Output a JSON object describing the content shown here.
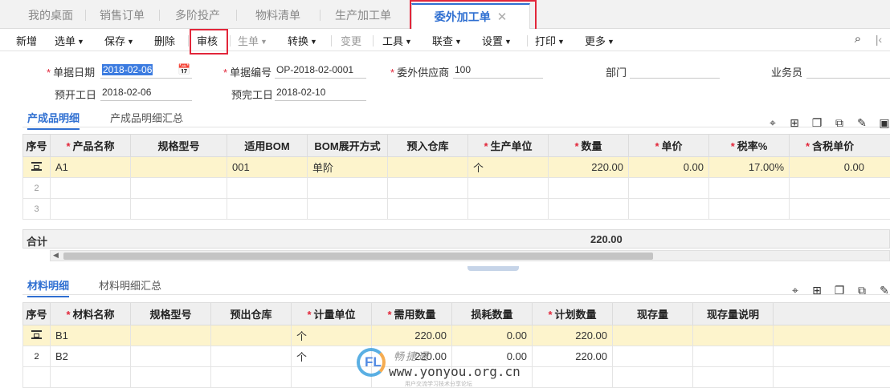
{
  "tabs": [
    {
      "label": "我的桌面"
    },
    {
      "label": "销售订单"
    },
    {
      "label": "多阶投产"
    },
    {
      "label": "物料清单"
    },
    {
      "label": "生产加工单"
    },
    {
      "label": "委外加工单",
      "close": "✕"
    }
  ],
  "toolbar": {
    "new": "新增",
    "select": "选单",
    "save": "保存",
    "delete": "删除",
    "audit": "审核",
    "generate": "生单",
    "convert": "转换",
    "change": "变更",
    "tools": "工具",
    "linked": "联查",
    "settings": "设置",
    "print": "打印",
    "more": "更多"
  },
  "header": {
    "date_label": "单据日期",
    "date_value": "2018-02-06",
    "number_label": "单据编号",
    "number_value": "OP-2018-02-0001",
    "supplier_label": "委外供应商",
    "supplier_value": "100",
    "dept_label": "部门",
    "dept_value": "",
    "salesman_label": "业务员",
    "salesman_value": "",
    "plan_start_label": "预开工日",
    "plan_start_value": "2018-02-06",
    "plan_end_label": "预完工日",
    "plan_end_value": "2018-02-10"
  },
  "product_section": {
    "tab_detail": "产成品明细",
    "tab_summary": "产成品明细汇总",
    "columns": [
      "序号",
      "产品名称",
      "规格型号",
      "适用BOM",
      "BOM展开方式",
      "预入仓库",
      "生产单位",
      "数量",
      "单价",
      "税率%",
      "含税单价"
    ],
    "rows": [
      {
        "idx": "",
        "name": "A1",
        "spec": "",
        "bom": "001",
        "expand": "单阶",
        "warehouse": "",
        "unit": "个",
        "qty": "220.00",
        "price": "0.00",
        "tax": "17.00%",
        "taxprice": "0.00"
      },
      {
        "idx": "2",
        "name": "",
        "spec": "",
        "bom": "",
        "expand": "",
        "warehouse": "",
        "unit": "",
        "qty": "",
        "price": "",
        "tax": "",
        "taxprice": ""
      },
      {
        "idx": "3",
        "name": "",
        "spec": "",
        "bom": "",
        "expand": "",
        "warehouse": "",
        "unit": "",
        "qty": "",
        "price": "",
        "tax": "",
        "taxprice": ""
      }
    ],
    "total_label": "合计",
    "total_qty": "220.00"
  },
  "material_section": {
    "tab_detail": "材料明细",
    "tab_summary": "材料明细汇总",
    "columns": [
      "序号",
      "材料名称",
      "规格型号",
      "预出仓库",
      "计量单位",
      "需用数量",
      "损耗数量",
      "计划数量",
      "现存量",
      "现存量说明"
    ],
    "rows": [
      {
        "idx": "",
        "name": "B1",
        "spec": "",
        "warehouse": "",
        "unit": "个",
        "need": "220.00",
        "loss": "0.00",
        "plan": "220.00",
        "stock": "",
        "stock_note": ""
      },
      {
        "idx": "2",
        "name": "B2",
        "spec": "",
        "warehouse": "",
        "unit": "个",
        "need": "220.00",
        "loss": "0.00",
        "plan": "220.00",
        "stock": "",
        "stock_note": ""
      }
    ]
  },
  "watermark": {
    "logo": "FL",
    "site": "www.yonyou.org.cn",
    "top": "畅捷通",
    "sub": "用户交流学习技术分享论坛"
  },
  "colors": {
    "accent": "#2f6fd1",
    "highlight": "#e2263a",
    "row_selected": "#fdf4cc"
  }
}
